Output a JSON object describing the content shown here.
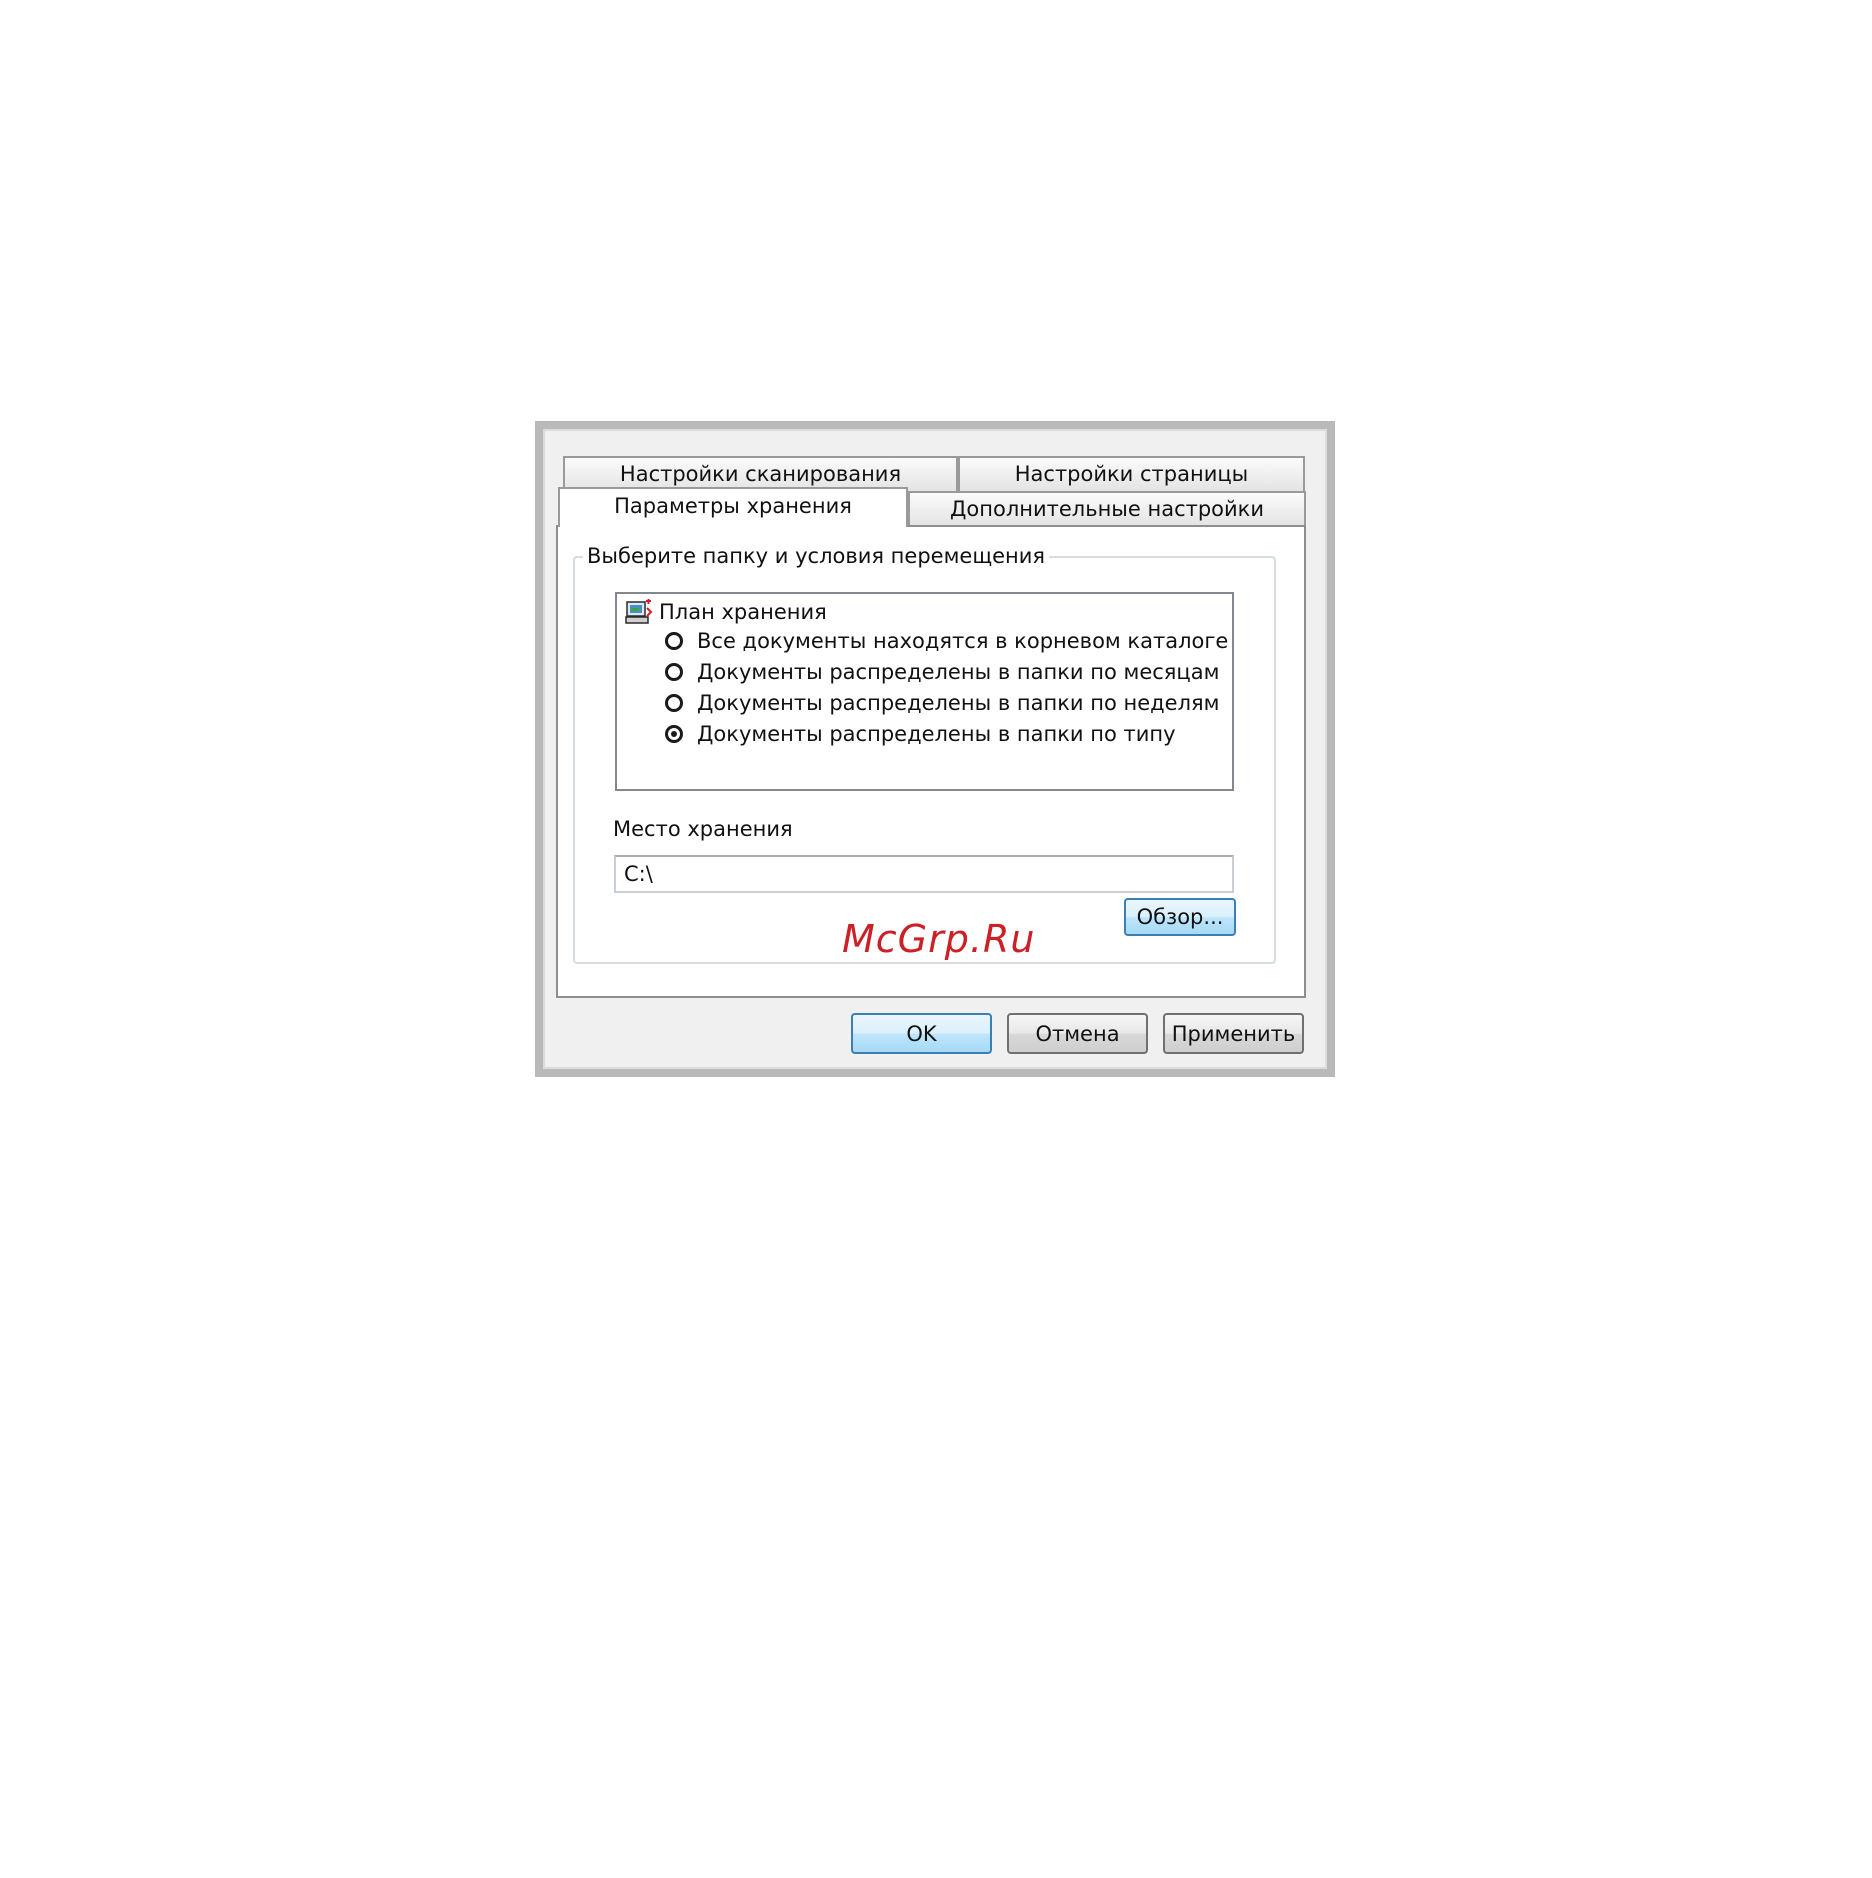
{
  "dialog": {
    "tabs": {
      "scan_settings": "Настройки сканирования",
      "page_settings": "Настройки страницы",
      "storage_options": "Параметры хранения",
      "advanced_settings": "Дополнительные настройки"
    },
    "group_title": "Выберите папку и условия перемещения",
    "tree": {
      "root_label": "План хранения",
      "root_icon": "storage-plan-icon",
      "options": [
        {
          "label": "Все документы находятся в корневом каталоге",
          "checked": false
        },
        {
          "label": "Документы распределены в папки по месяцам",
          "checked": false
        },
        {
          "label": "Документы распределены в папки по неделям",
          "checked": false
        },
        {
          "label": "Документы распределены в папки по типу",
          "checked": true
        }
      ]
    },
    "location_label": "Место хранения",
    "location_value": "C:\\",
    "browse_button": "Обзор...",
    "buttons": {
      "ok": "OK",
      "cancel": "Отмена",
      "apply": "Применить"
    }
  },
  "watermark": "McGrp.Ru",
  "colors": {
    "default_button_border": "#3c7fb1",
    "watermark": "#cc2027"
  }
}
